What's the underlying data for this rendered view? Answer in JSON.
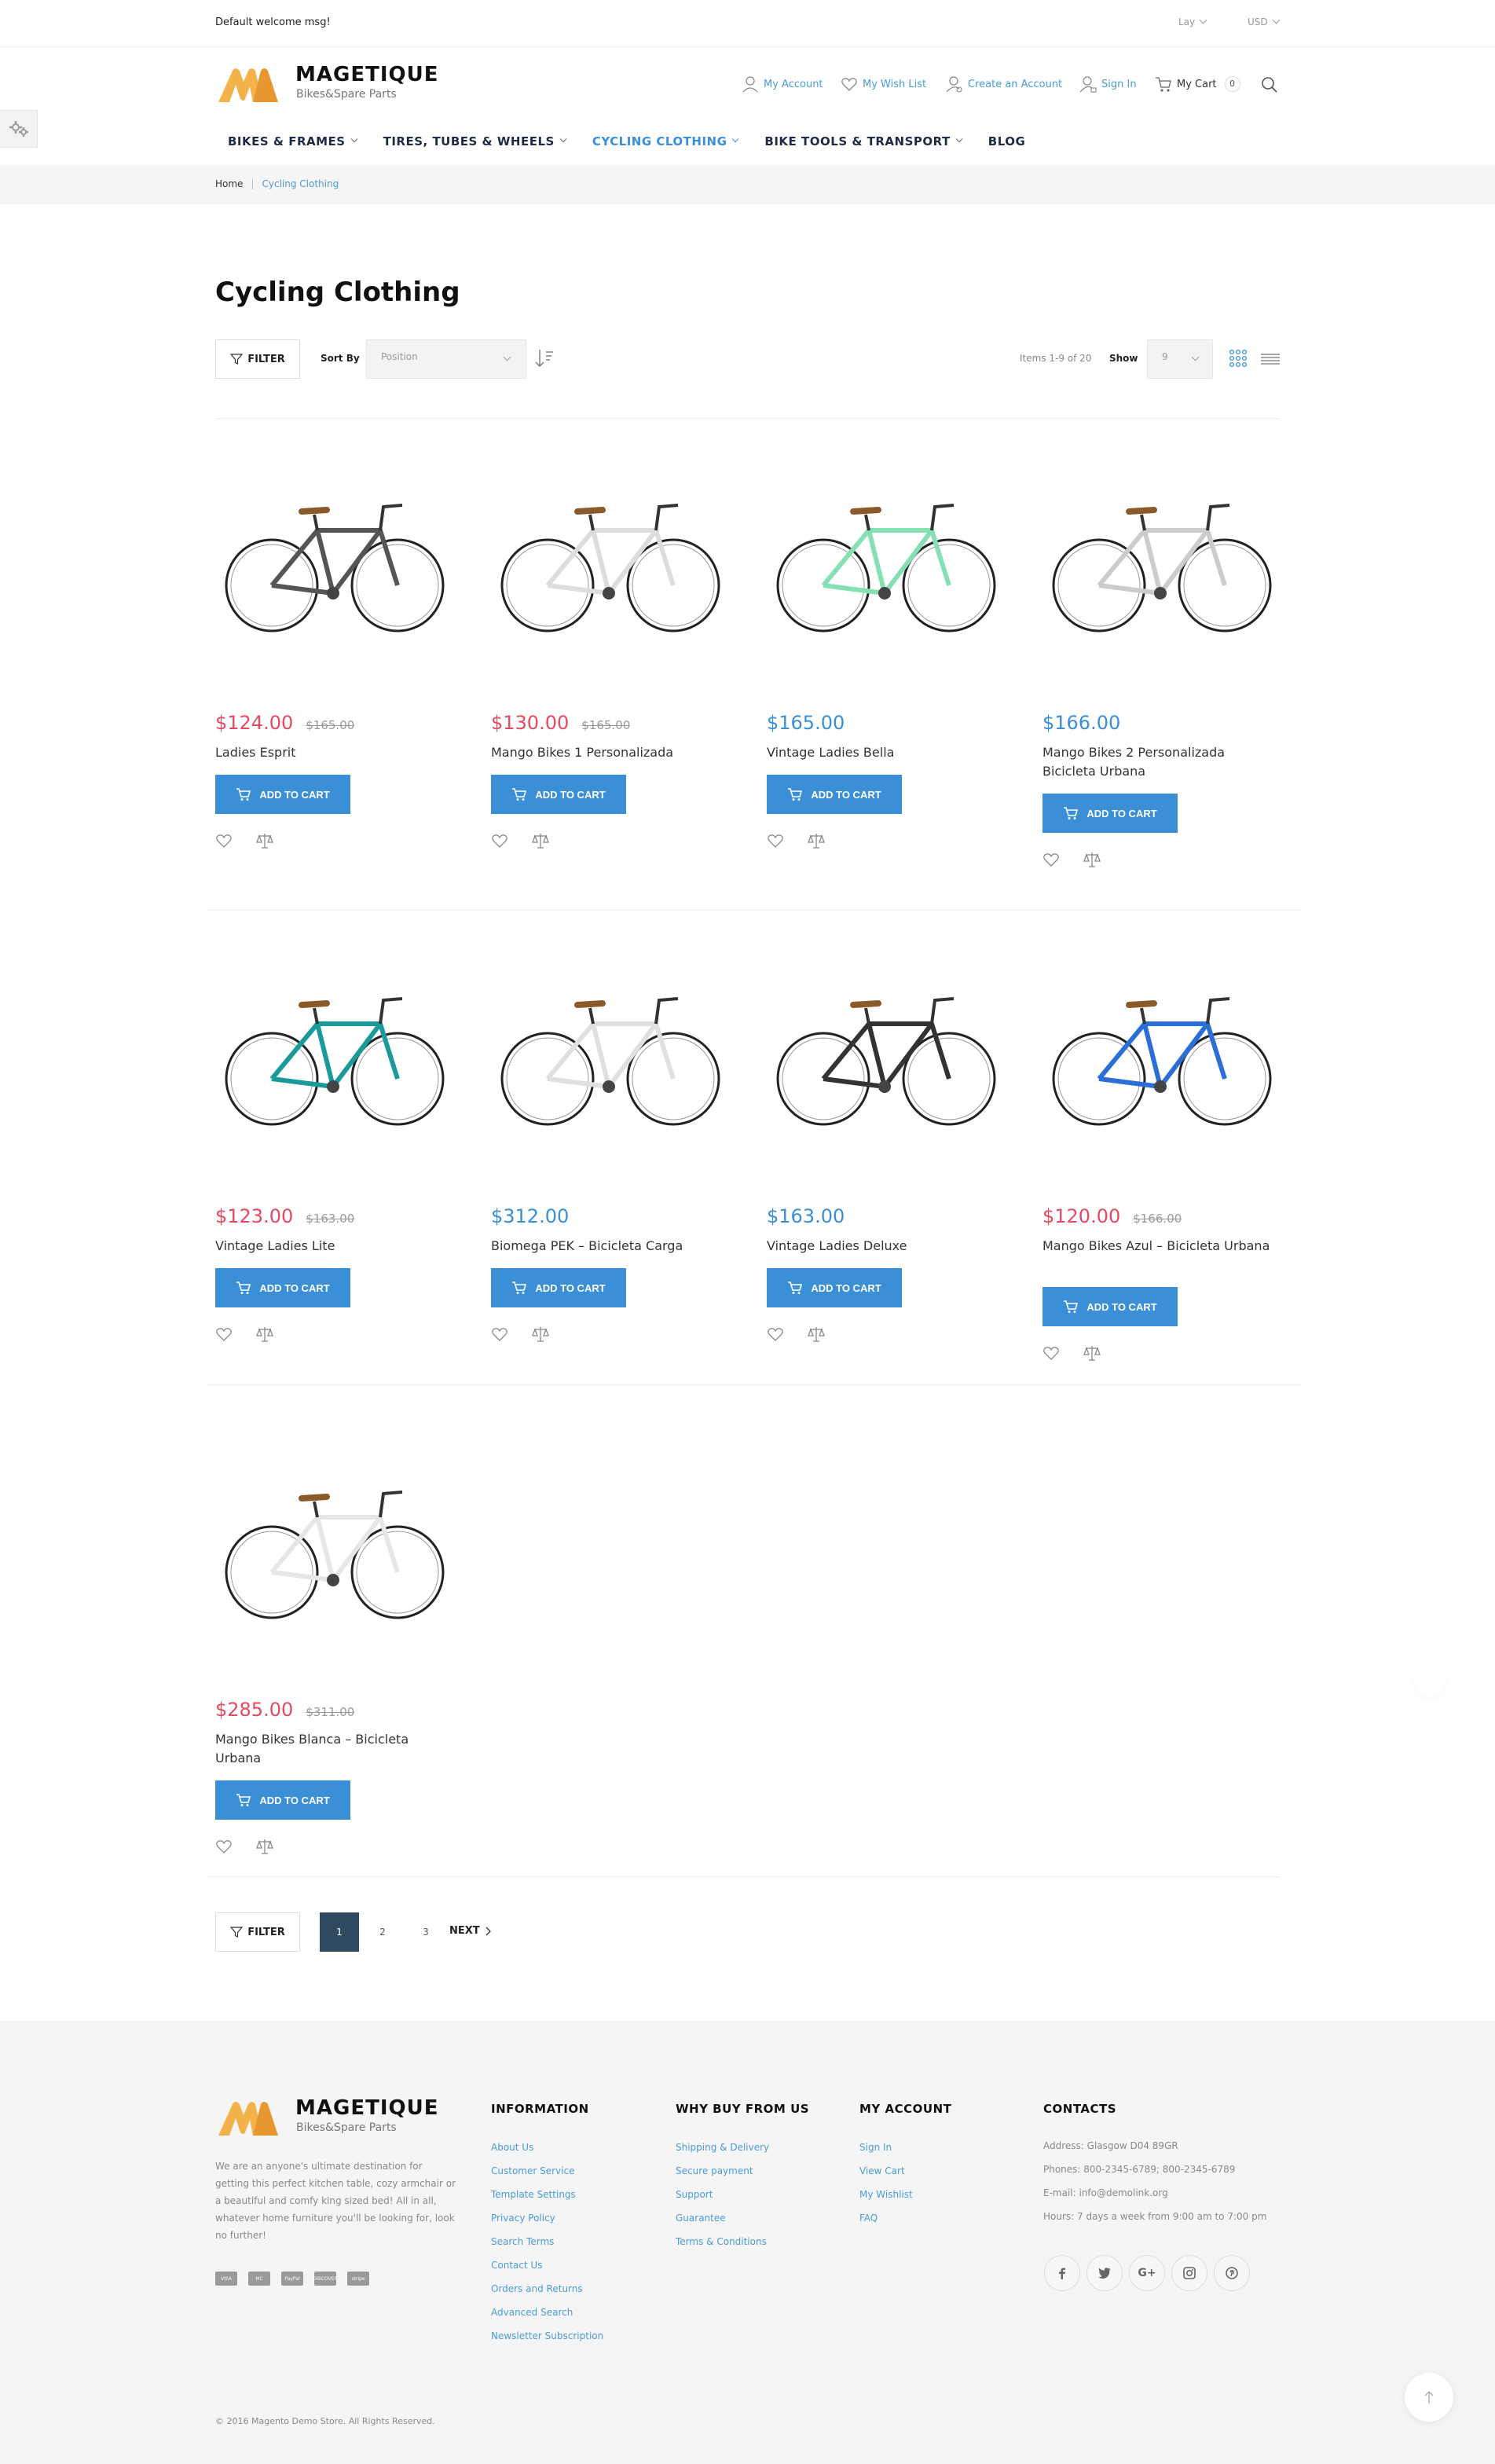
{
  "topbar": {
    "welcome": "Default welcome msg!",
    "language": "Lay",
    "currency": "USD"
  },
  "logo": {
    "name": "MAGETIQUE",
    "tagline": "Bikes&Spare Parts"
  },
  "header_links": {
    "account": "My Account",
    "wishlist": "My Wish List",
    "create": "Create an Account",
    "signin": "Sign In",
    "cart": "My Cart",
    "cart_count": "0"
  },
  "nav": [
    {
      "label": "BIKES & FRAMES"
    },
    {
      "label": "TIRES, TUBES & WHEELS"
    },
    {
      "label": "CYCLING CLOTHING"
    },
    {
      "label": "BIKE TOOLS & TRANSPORT"
    },
    {
      "label": "BLOG"
    }
  ],
  "breadcrumb": {
    "home": "Home",
    "current": "Cycling Clothing"
  },
  "page_title": "Cycling Clothing",
  "toolbar": {
    "filter": "FILTER",
    "sort_label": "Sort By",
    "sort_value": "Position",
    "items_info": "Items 1-9 of 20",
    "show_label": "Show",
    "show_value": "9"
  },
  "products": [
    {
      "price": "$124.00",
      "old_price": "$165.00",
      "name": "Ladies Esprit",
      "color": "#555555"
    },
    {
      "price": "$130.00",
      "old_price": "$165.00",
      "name": "Mango Bikes 1 Personalizada",
      "color": "#dddddd"
    },
    {
      "price": "$165.00",
      "old_price": "",
      "name": "Vintage Ladies Bella",
      "color": "#86e0b4"
    },
    {
      "price": "$166.00",
      "old_price": "",
      "name": "Mango Bikes 2 Personalizada Bicicleta Urbana",
      "color": "#cccccc"
    },
    {
      "price": "$123.00",
      "old_price": "$163.00",
      "name": "Vintage Ladies Lite",
      "color": "#1a9a9a"
    },
    {
      "price": "$312.00",
      "old_price": "",
      "name": "Biomega PEK – Bicicleta Carga",
      "color": "#e0e0e0"
    },
    {
      "price": "$163.00",
      "old_price": "",
      "name": "Vintage Ladies Deluxe",
      "color": "#333333"
    },
    {
      "price": "$120.00",
      "old_price": "$166.00",
      "name": "Mango Bikes Azul – Bicicleta Urbana",
      "color": "#2a6ed6"
    },
    {
      "price": "$285.00",
      "old_price": "$311.00",
      "name": "Mango Bikes Blanca – Bicicleta Urbana",
      "color": "#e6e6e6"
    }
  ],
  "add_to_cart": "ADD TO CART",
  "pager": {
    "pages": [
      "1",
      "2",
      "3"
    ],
    "next": "NEXT"
  },
  "footer": {
    "about": "We are an anyone's ultimate destination for getting this perfect kitchen table, cozy armchair or a beautiful and comfy king sized bed! All in all, whatever home furniture you'll be looking for, look no further!",
    "payments": [
      "VISA",
      "MC",
      "PayPal",
      "DISCOVER",
      "stripe"
    ],
    "info_title": "INFORMATION",
    "info_links": [
      "About Us",
      "Customer Service",
      "Template Settings",
      "Privacy Policy",
      "Search Terms",
      "Contact Us",
      "Orders and Returns",
      "Advanced Search",
      "Newsletter Subscription"
    ],
    "why_title": "WHY BUY FROM US",
    "why_links": [
      "Shipping & Delivery",
      "Secure payment",
      "Support",
      "Guarantee",
      "Terms & Conditions"
    ],
    "account_title": "MY ACCOUNT",
    "account_links": [
      "Sign In",
      "View Cart",
      "My Wishlist",
      "FAQ"
    ],
    "contacts_title": "CONTACTS",
    "contacts": [
      "Address: Glasgow D04 89GR",
      "Phones: 800-2345-6789; 800-2345-6789",
      "E-mail: info@demolink.org",
      "Hours: 7 days a week from 9:00 am to 7:00 pm"
    ],
    "copyright": "© 2016 Magento Demo Store. All Rights Reserved."
  },
  "colors": {
    "accent": "#3a8fd6",
    "sale": "#e74a60",
    "pager_active": "#2f4a5e"
  }
}
